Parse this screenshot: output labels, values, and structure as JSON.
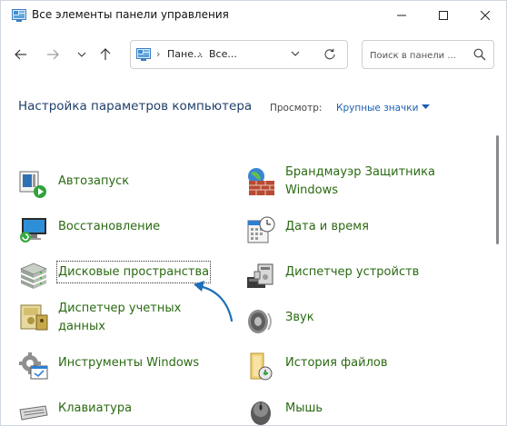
{
  "window": {
    "title": "Все элементы панели управления"
  },
  "address_bar": {
    "breadcrumbs": [
      "Пане...",
      "Все..."
    ],
    "separator": "›"
  },
  "search": {
    "placeholder": "Поиск в панели ..."
  },
  "header": {
    "title": "Настройка параметров компьютера",
    "view_label": "Просмотр:",
    "view_value": "Крупные значки"
  },
  "items_left": [
    {
      "label": "Автозапуск",
      "icon": "autoplay-icon"
    },
    {
      "label": "Восстановление",
      "icon": "recovery-icon"
    },
    {
      "label": "Дисковые пространства",
      "icon": "storage-spaces-icon"
    },
    {
      "label_line1": "Диспетчер учетных",
      "label_line2": "данных",
      "icon": "credential-manager-icon"
    },
    {
      "label": "Инструменты Windows",
      "icon": "windows-tools-icon"
    },
    {
      "label": "Клавиатура",
      "icon": "keyboard-icon"
    }
  ],
  "items_right": [
    {
      "label_line1": "Брандмауэр Защитника",
      "label_line2": "Windows",
      "icon": "firewall-icon"
    },
    {
      "label": "Дата и время",
      "icon": "date-time-icon"
    },
    {
      "label": "Диспетчер устройств",
      "icon": "device-manager-icon"
    },
    {
      "label": "Звук",
      "icon": "sound-icon"
    },
    {
      "label": "История файлов",
      "icon": "file-history-icon"
    },
    {
      "label": "Мышь",
      "icon": "mouse-icon"
    }
  ],
  "colors": {
    "link_green": "#2a6a12",
    "title_blue": "#1f3f6a",
    "accent_blue": "#1a5fb4"
  }
}
